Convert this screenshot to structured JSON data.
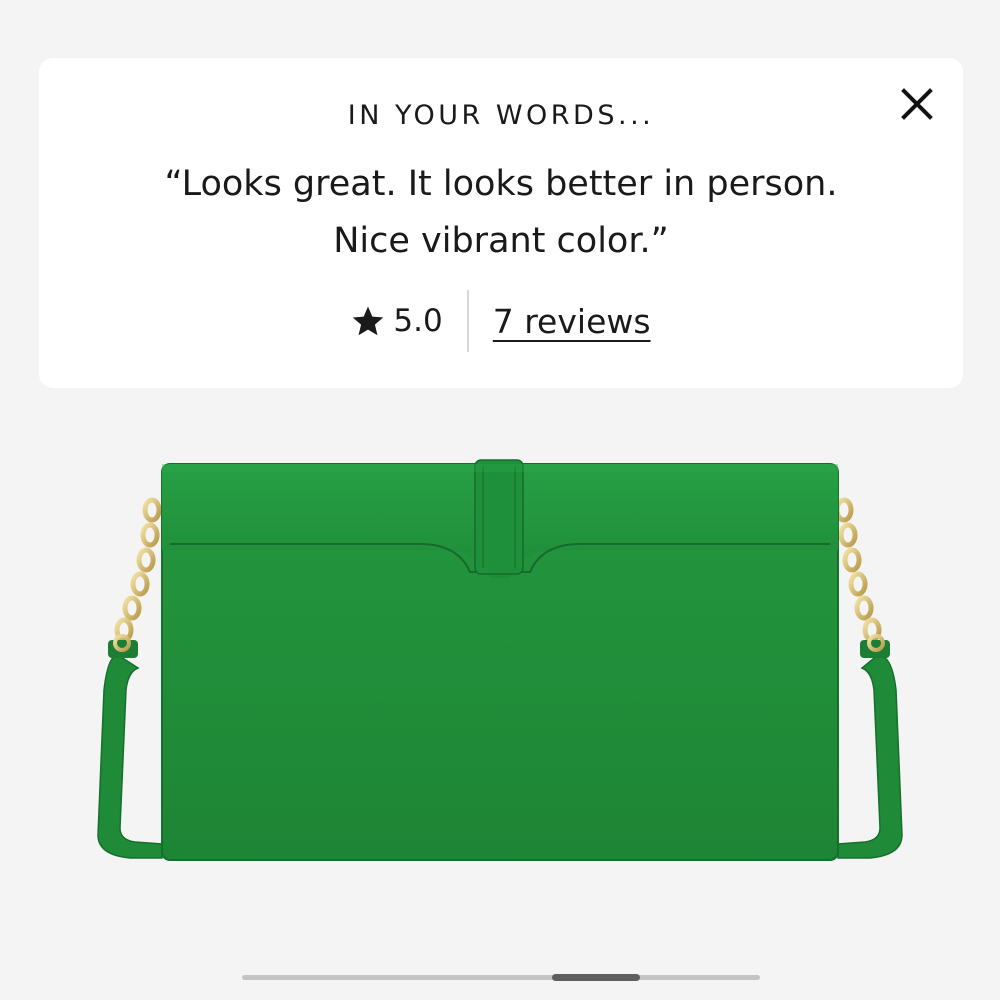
{
  "review_card": {
    "heading": "IN YOUR WORDS...",
    "quote_line1": "“Looks great. It looks better in person.",
    "quote_line2": "Nice vibrant color.”",
    "rating": "5.0",
    "reviews_link": "7 reviews",
    "close_icon": "close-icon",
    "star_icon": "star-icon"
  },
  "product": {
    "image_alt": "green-crossbody-bag",
    "color": "#1e8a3a"
  },
  "carousel": {
    "progress": 0.72
  }
}
